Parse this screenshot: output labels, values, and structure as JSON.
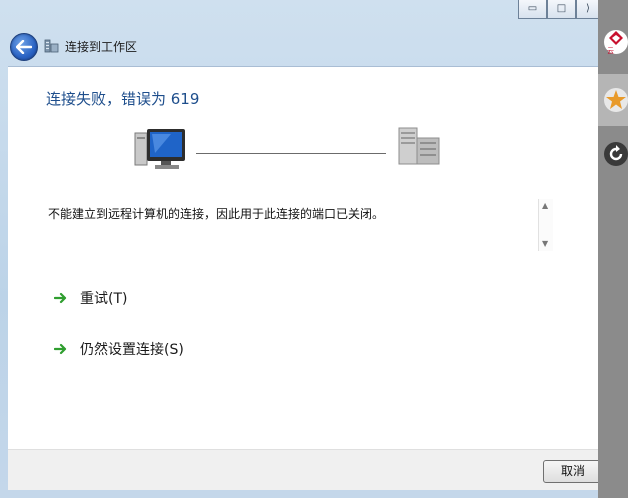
{
  "window": {
    "breadcrumb": "连接到工作区",
    "minimize_glyph": "▭",
    "maximize_glyph": "□",
    "close_glyph": "⟩"
  },
  "content": {
    "heading": "连接失败，错误为 619",
    "message": "不能建立到远程计算机的连接，因此用于此连接的端口已关闭。",
    "actions": [
      {
        "label": "重试(T)",
        "icon": "green-arrow-icon"
      },
      {
        "label": "仍然设置连接(S)",
        "icon": "green-arrow-icon"
      }
    ]
  },
  "footer": {
    "cancel_label": "取消"
  },
  "side_panel": {
    "app_badge_text": "云"
  },
  "colors": {
    "heading": "#1e4e8c",
    "accent_green": "#2f9e2f"
  }
}
